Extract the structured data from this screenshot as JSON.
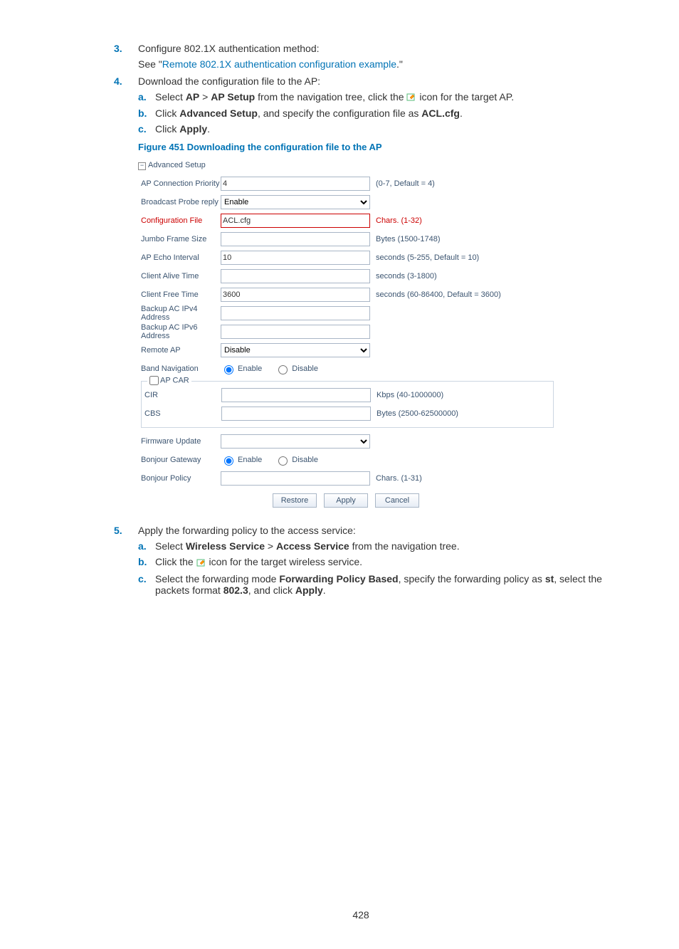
{
  "steps": {
    "s3": {
      "num": "3.",
      "text": "Configure 802.1X authentication method:"
    },
    "s3see1": "See \"",
    "s3link": "Remote 802.1X authentication configuration example",
    "s3see2": ".\"",
    "s4": {
      "num": "4.",
      "text": "Download the configuration file to the AP:"
    },
    "s4a_letter": "a.",
    "s4a_t1": "Select ",
    "s4a_ap": "AP",
    "s4a_gt": " > ",
    "s4a_setup": "AP Setup",
    "s4a_t2": " from the navigation tree, click the ",
    "s4a_t3": " icon for the target AP.",
    "s4b_letter": "b.",
    "s4b_t1": "Click ",
    "s4b_adv": "Advanced Setup",
    "s4b_t2": ", and specify the configuration file as ",
    "s4b_acl": "ACL.cfg",
    "s4b_t3": ".",
    "s4c_letter": "c.",
    "s4c_t1": "Click ",
    "s4c_apply": "Apply",
    "s4c_t2": ".",
    "caption": "Figure 451 Downloading the configuration file to the AP",
    "s5": {
      "num": "5.",
      "text": "Apply the forwarding policy to the access service:"
    },
    "s5a_letter": "a.",
    "s5a_t1": "Select ",
    "s5a_ws": "Wireless Service",
    "s5a_gt": " > ",
    "s5a_as": "Access Service",
    "s5a_t2": " from the navigation tree.",
    "s5b_letter": "b.",
    "s5b_t1": "Click the ",
    "s5b_t2": " icon for the target wireless service.",
    "s5c_letter": "c.",
    "s5c_t1": "Select the forwarding mode ",
    "s5c_fp": "Forwarding Policy Based",
    "s5c_t2": ", specify the forwarding policy as ",
    "s5c_st": "st",
    "s5c_t3": ", select the packets format ",
    "s5c_8023": "802.3",
    "s5c_t4": ", and click ",
    "s5c_apply": "Apply",
    "s5c_t5": "."
  },
  "panel": {
    "header": "Advanced Setup",
    "rows": {
      "ap_prio": {
        "label": "AP Connection Priority",
        "value": "4",
        "hint": "(0-7, Default = 4)"
      },
      "bcast": {
        "label": "Broadcast Probe reply",
        "value": "Enable"
      },
      "cfgfile": {
        "label": "Configuration File",
        "value": "ACL.cfg",
        "hint": "Chars. (1-32)"
      },
      "jumbo": {
        "label": "Jumbo Frame Size",
        "value": "",
        "hint": "Bytes (1500-1748)"
      },
      "echo": {
        "label": "AP Echo Interval",
        "value": "10",
        "hint": "seconds (5-255, Default = 10)"
      },
      "calive": {
        "label": "Client Alive Time",
        "value": "",
        "hint": "seconds (3-1800)"
      },
      "cfree": {
        "label": "Client Free Time",
        "value": "3600",
        "hint": "seconds (60-86400, Default = 3600)"
      },
      "b4": {
        "label": "Backup AC IPv4 Address",
        "value": ""
      },
      "b6": {
        "label": "Backup AC IPv6 Address",
        "value": ""
      },
      "remote": {
        "label": "Remote AP",
        "value": "Disable"
      },
      "band": {
        "label": "Band Navigation",
        "enable": "Enable",
        "disable": "Disable"
      },
      "apcar": {
        "legend": "AP CAR"
      },
      "cir": {
        "label": "CIR",
        "value": "",
        "hint": "Kbps (40-1000000)"
      },
      "cbs": {
        "label": "CBS",
        "value": "",
        "hint": "Bytes (2500-62500000)"
      },
      "fw": {
        "label": "Firmware Update",
        "value": ""
      },
      "bgw": {
        "label": "Bonjour Gateway",
        "enable": "Enable",
        "disable": "Disable"
      },
      "bpol": {
        "label": "Bonjour Policy",
        "value": "",
        "hint": "Chars. (1-31)"
      }
    },
    "buttons": {
      "restore": "Restore",
      "apply": "Apply",
      "cancel": "Cancel"
    }
  },
  "page_number": "428"
}
